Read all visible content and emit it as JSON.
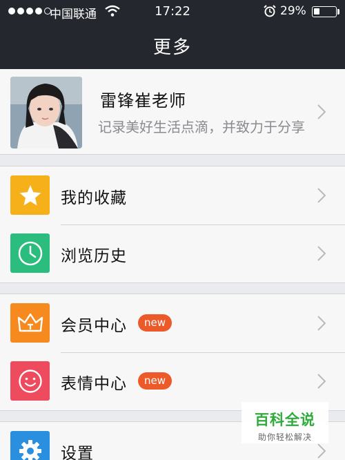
{
  "status_bar": {
    "carrier": "中国联通",
    "time": "17:22",
    "battery_percent": "29%",
    "battery_level": 0.29,
    "signal_bars": 4,
    "signal_total": 5
  },
  "nav": {
    "title": "更多"
  },
  "profile": {
    "name": "雷锋崔老师",
    "description": "记录美好生活点滴，并致力于分享"
  },
  "menu_groups": [
    {
      "items": [
        {
          "label": "我的收藏",
          "icon": "star-icon",
          "color": "#f6b11a"
        },
        {
          "label": "浏览历史",
          "icon": "clock-icon",
          "color": "#2bbd7e"
        }
      ]
    },
    {
      "items": [
        {
          "label": "会员中心",
          "icon": "crown-icon",
          "color": "#f68a1f",
          "badge": "new"
        },
        {
          "label": "表情中心",
          "icon": "smiley-icon",
          "color": "#ef4b5e",
          "badge": "new"
        }
      ]
    },
    {
      "items": [
        {
          "label": "设置",
          "icon": "gear-icon",
          "color": "#2b8fe0"
        }
      ]
    }
  ],
  "watermark": {
    "title": "百科全说",
    "subtitle": "助你轻松解决"
  },
  "colors": {
    "navbar": "#25272e",
    "background": "#e9ebef",
    "badge": "#ec5a2a",
    "watermark_green": "#2eab3a"
  }
}
